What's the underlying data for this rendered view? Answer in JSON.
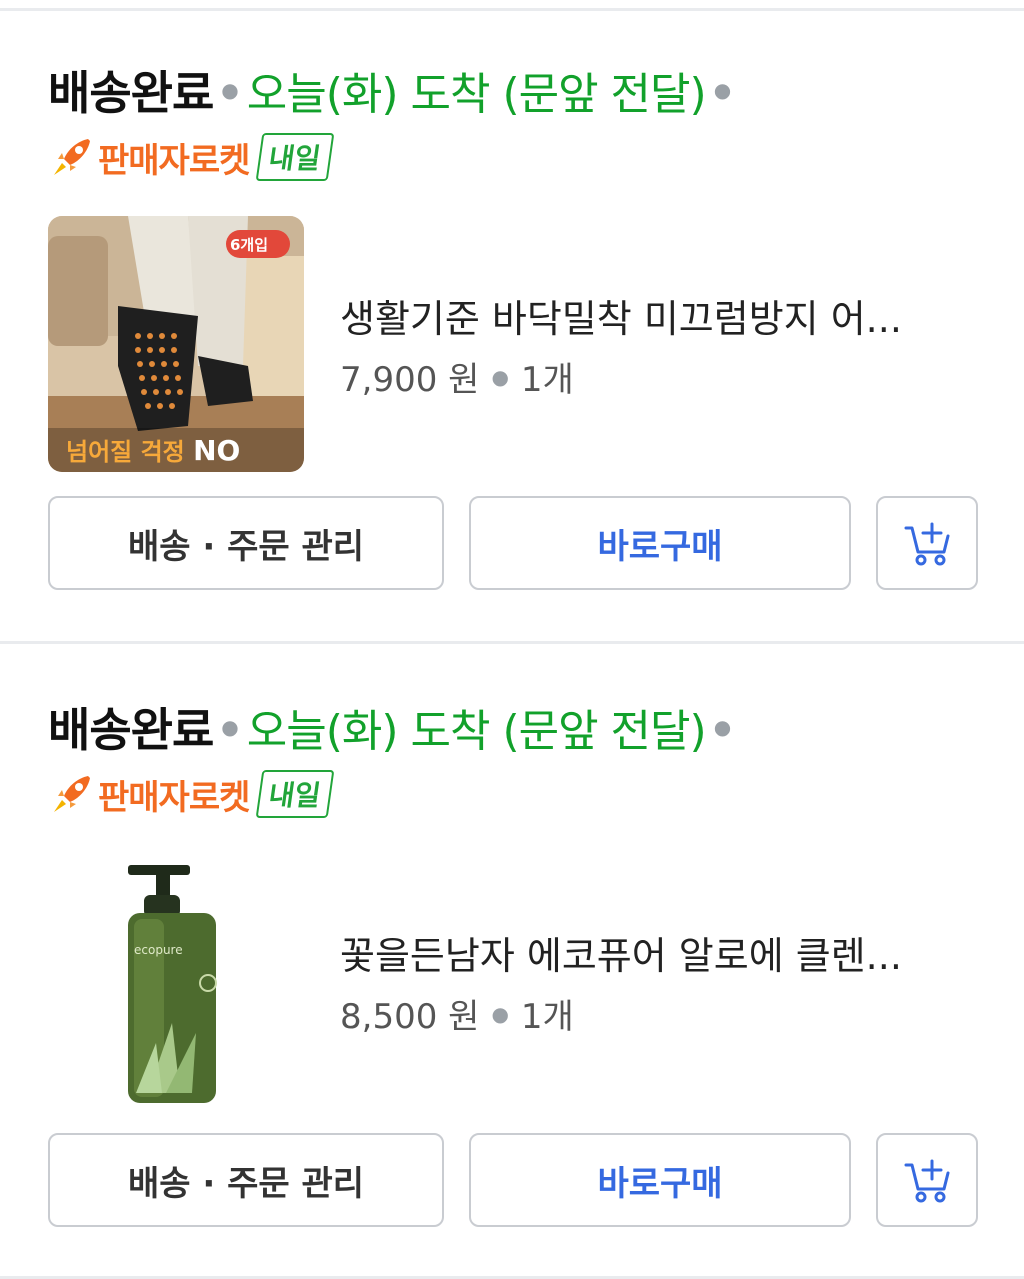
{
  "orders": [
    {
      "status": "배송완료",
      "arrival": "오늘(화) 도착 (문앞 전달)",
      "rocket_label": "판매자로켓",
      "tomorrow_badge": "내일",
      "product_title": "생활기준 바닥밀착 미끄럼방지 어...",
      "price": "7,900 원",
      "quantity": "1개",
      "thumb_badge": "6개입",
      "thumb_caption_a": "넘어질 걱정 ",
      "thumb_caption_b": "NO",
      "manage_label": "배송 · 주문 관리",
      "buy_label": "바로구매",
      "cart_icon": "add-to-cart-icon"
    },
    {
      "status": "배송완료",
      "arrival": "오늘(화) 도착 (문앞 전달)",
      "rocket_label": "판매자로켓",
      "tomorrow_badge": "내일",
      "product_title": "꽃을든남자 에코퓨어 알로에 클렌...",
      "price": "8,500 원",
      "quantity": "1개",
      "thumb_brand": "ecopure",
      "manage_label": "배송 · 주문 관리",
      "buy_label": "바로구매",
      "cart_icon": "add-to-cart-icon"
    }
  ],
  "colors": {
    "arrival_green": "#12a12b",
    "rocket_orange": "#f26b21",
    "buy_blue": "#3569e0",
    "divider": "#e9ebee"
  }
}
